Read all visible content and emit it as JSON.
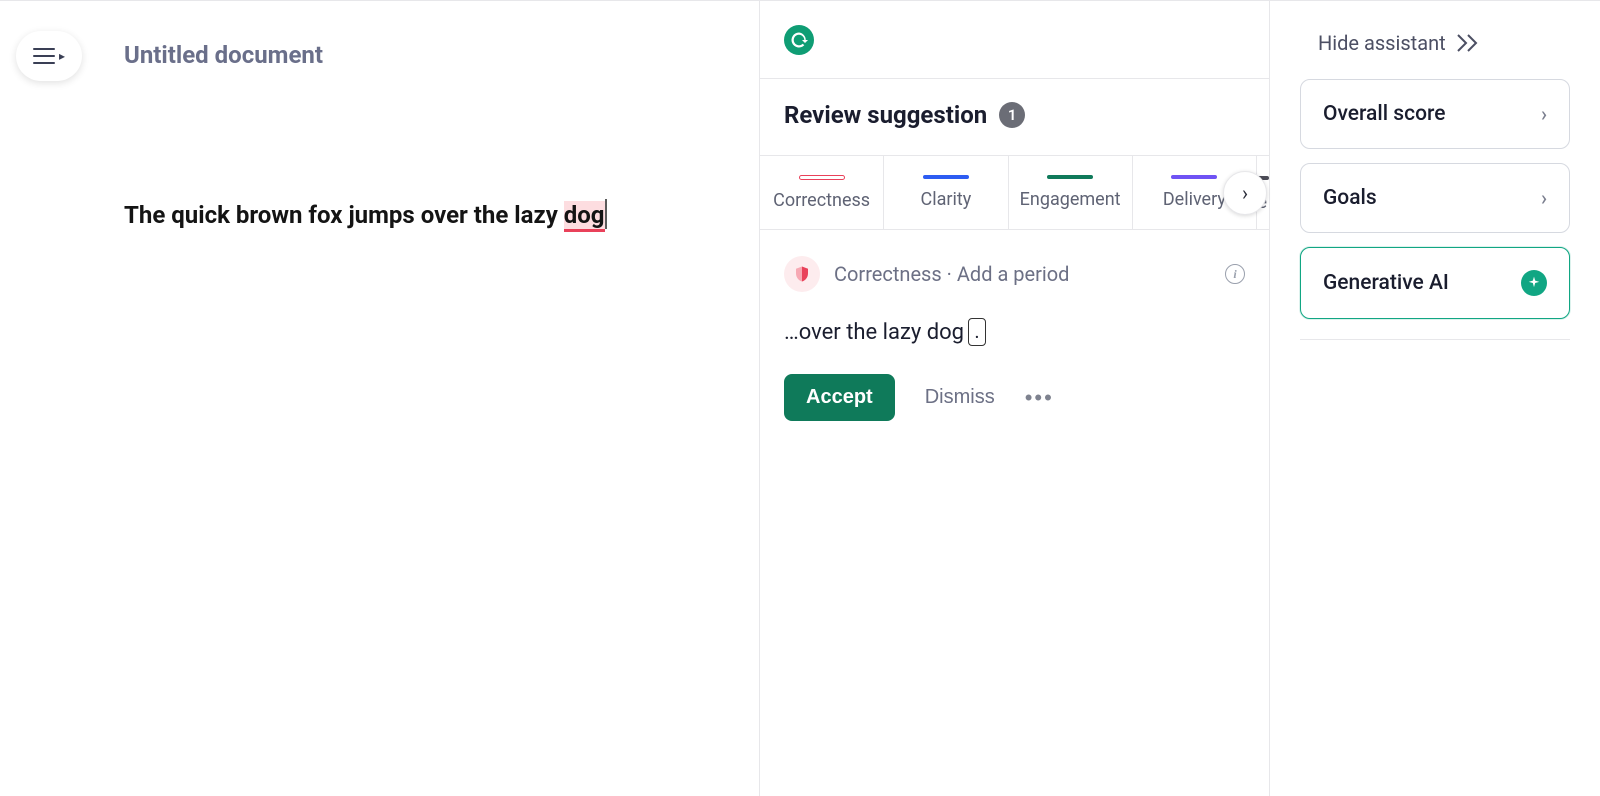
{
  "editor": {
    "menu_icon": "hamburger",
    "title": "Untitled document",
    "text_normal": "The quick brown fox jumps over the lazy ",
    "text_flagged": "dog"
  },
  "suggestions": {
    "review_title": "Review suggestion",
    "count": "1",
    "tabs": [
      {
        "key": "correctness",
        "label": "Correctness"
      },
      {
        "key": "clarity",
        "label": "Clarity"
      },
      {
        "key": "engagement",
        "label": "Engagement"
      },
      {
        "key": "delivery",
        "label": "Delivery"
      }
    ],
    "card": {
      "category": "Correctness",
      "separator": " · ",
      "action_desc": "Add a period",
      "preview_prefix": "…over the lazy dog",
      "preview_insert": ".",
      "accept_label": "Accept",
      "dismiss_label": "Dismiss"
    }
  },
  "assistant": {
    "hide_label": "Hide assistant",
    "items": [
      {
        "label": "Overall score",
        "variant": "default"
      },
      {
        "label": "Goals",
        "variant": "default"
      },
      {
        "label": "Generative AI",
        "variant": "genai"
      }
    ]
  },
  "colors": {
    "brand_green": "#0f7a5a",
    "correctness_red": "#e9415a",
    "clarity_blue": "#2d5cf2",
    "delivery_purple": "#6f53f4"
  }
}
